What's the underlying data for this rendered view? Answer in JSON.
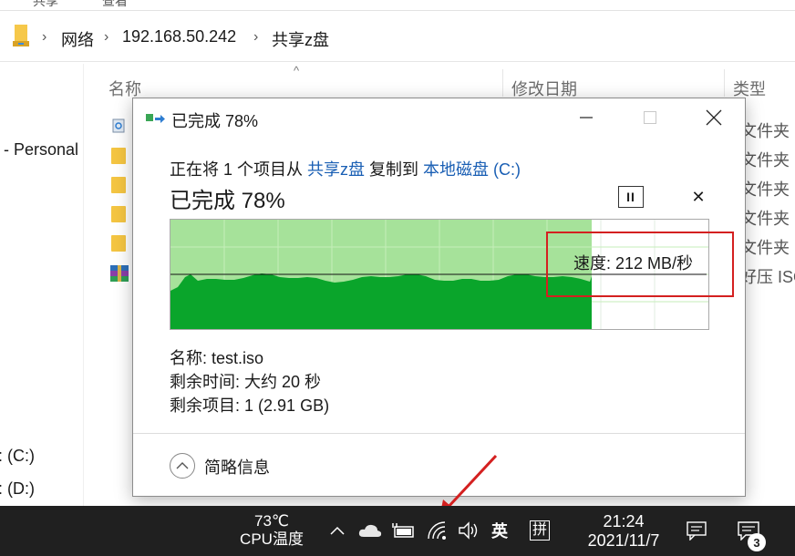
{
  "explorer": {
    "ribbon_fragments": [
      "共享",
      "查看"
    ],
    "breadcrumb": [
      "网络",
      "192.168.50.242",
      "共享z盘"
    ],
    "nav_items": [
      {
        "label": "- Personal"
      },
      {
        "label": ": (C:)"
      },
      {
        "label": ": (D:)"
      }
    ],
    "columns": {
      "name": "名称",
      "date": "修改日期",
      "type": "类型"
    },
    "rows": [
      {
        "icon": "recycle-icon",
        "type": "文件夹"
      },
      {
        "icon": "folder-icon",
        "type": "文件夹"
      },
      {
        "icon": "folder-icon",
        "type": "文件夹"
      },
      {
        "icon": "folder-icon",
        "type": "文件夹"
      },
      {
        "icon": "folder-icon",
        "type": "文件夹"
      },
      {
        "icon": "winrar-icon",
        "type": "好压 ISO"
      }
    ]
  },
  "dialog": {
    "title": "已完成 78%",
    "copy_prefix": "正在将 1 个项目从 ",
    "source": "共享z盘",
    "copy_middle": " 复制到 ",
    "destination": "本地磁盘 (C:)",
    "progress_title": "已完成 78%",
    "progress_fraction": 0.78,
    "speed": "速度: 212 MB/秒",
    "details": [
      {
        "key": "名称:",
        "value": "test.iso"
      },
      {
        "key": "剩余时间:",
        "value": "大约 20 秒"
      },
      {
        "key": "剩余项目:",
        "value": "1 (2.91 GB)"
      }
    ],
    "fewer_details": "简略信息",
    "pause_glyph": "II",
    "cancel_glyph": "✕"
  },
  "taskbar": {
    "cpu_temp": "73℃",
    "cpu_label": "CPU温度",
    "ime_lang": "英",
    "ime_mode": "拼",
    "time": "21:24",
    "date": "2021/11/7",
    "notification_count": "3"
  },
  "colors": {
    "graph_fill": "#0aa52b",
    "graph_area": "#a6e29a",
    "highlight": "#d42020",
    "link": "#1a5fb4",
    "taskbar": "#202020"
  }
}
